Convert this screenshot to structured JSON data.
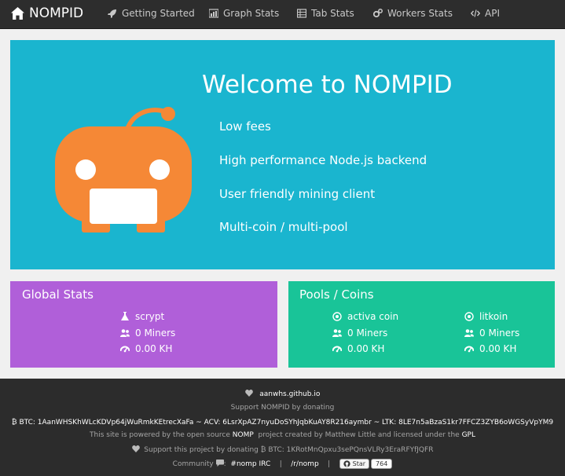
{
  "navbar": {
    "brand": "NOMPID",
    "items": [
      {
        "label": "Getting Started",
        "icon": "rocket-icon"
      },
      {
        "label": "Graph Stats",
        "icon": "bar-chart-icon"
      },
      {
        "label": "Tab Stats",
        "icon": "table-icon"
      },
      {
        "label": "Workers Stats",
        "icon": "gears-icon"
      },
      {
        "label": "API",
        "icon": "code-icon"
      }
    ]
  },
  "hero": {
    "title": "Welcome to NOMPID",
    "features": [
      "Low fees",
      "High performance Node.js backend",
      "User friendly mining client",
      "Multi-coin / multi-pool"
    ],
    "colors": {
      "background": "#1ab5cf",
      "robot": "#f58836"
    }
  },
  "global_stats": {
    "title": "Global Stats",
    "algorithm": "scrypt",
    "miners": "0 Miners",
    "hashrate": "0.00 KH",
    "color": "#b05fd9"
  },
  "pools": {
    "title": "Pools / Coins",
    "color": "#19c498",
    "coins": [
      {
        "name": "activa coin",
        "miners": "0 Miners",
        "hashrate": "0.00 KH"
      },
      {
        "name": "litkoin",
        "miners": "0 Miners",
        "hashrate": "0.00 KH"
      }
    ]
  },
  "footer": {
    "site_link": "aanwhs.github.io",
    "support_text": "Support NOMPID by donating",
    "donation_line": "BTC: 1AanWHSKhWLcKDVp64jWuRmkKEtrecXaFa ~ ACV: 6LsrXpAZ7nyuDoSYhJqbKuAY8R216aymbr ~ LTK: 8LE7n5aBzaS1kr7FFCZ3ZYB6oWGSyVpYM9",
    "powered_prefix": "This site is powered by the open source",
    "nomp_link": "NOMP",
    "powered_mid": "project created by Matthew Little and licensed under the",
    "gpl_link": "GPL",
    "support_project": "Support this project by donating",
    "btc_project": "BTC: 1KRotMnQpxu3sePQnsVLRy3EraRFYfJQFR",
    "community_label": "Community",
    "irc_link": "#nomp IRC",
    "reddit_link": "/r/nomp",
    "separator": "|",
    "github_star": "Star",
    "github_count": "764"
  }
}
